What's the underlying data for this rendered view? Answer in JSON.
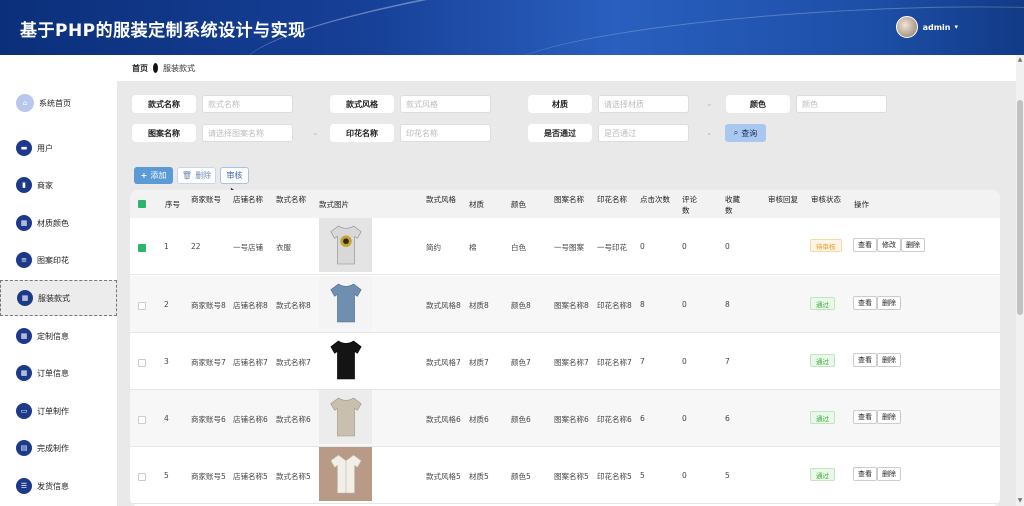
{
  "header": {
    "title": "基于PHP的服装定制系统设计与实现",
    "user": "admin",
    "caret": "▾"
  },
  "sidebar": {
    "items": [
      {
        "label": "系统首页",
        "icon": "home-icon"
      },
      {
        "label": "用户",
        "icon": "chat-icon"
      },
      {
        "label": "商家",
        "icon": "chart-icon"
      },
      {
        "label": "材质颜色",
        "icon": "grid-icon"
      },
      {
        "label": "图案印花",
        "icon": "list-icon"
      },
      {
        "label": "服装款式",
        "icon": "grid-icon"
      },
      {
        "label": "定制信息",
        "icon": "grid-icon"
      },
      {
        "label": "订单信息",
        "icon": "grid-icon"
      },
      {
        "label": "订单制作",
        "icon": "monitor-icon"
      },
      {
        "label": "完成制作",
        "icon": "clipboard-icon"
      },
      {
        "label": "发货信息",
        "icon": "sliders-icon"
      }
    ],
    "active_index": 5
  },
  "breadcrumb": {
    "home": "首页",
    "current": "服装款式"
  },
  "filters": {
    "style_name": {
      "label": "款式名称",
      "placeholder": "款式名称"
    },
    "style": {
      "label": "款式风格",
      "placeholder": "款式风格"
    },
    "material": {
      "label": "材质",
      "placeholder": "请选择材质"
    },
    "color": {
      "label": "颜色",
      "placeholder": "颜色"
    },
    "pattern_name": {
      "label": "图案名称",
      "placeholder": "请选择图案名称"
    },
    "print_name": {
      "label": "印花名称",
      "placeholder": "印花名称"
    },
    "approved": {
      "label": "是否通过",
      "placeholder": "是否通过"
    },
    "search_label": "查询"
  },
  "actions": {
    "add": "添加",
    "delete": "删除",
    "audit": "审核"
  },
  "table": {
    "headers": {
      "index": "序号",
      "merchant": "商家账号",
      "store": "店铺名称",
      "style_name": "款式名称",
      "image": "款式图片",
      "style": "款式风格",
      "material": "材质",
      "color": "颜色",
      "pattern": "图案名称",
      "print": "印花名称",
      "clicks": "点击次数",
      "comments": "评论数",
      "favorites": "收藏数",
      "reply": "审核回复",
      "status": "审核状态",
      "ops": "操作"
    },
    "rows": [
      {
        "index": "1",
        "merchant": "22",
        "store": "一号店铺",
        "style_name": "衣服",
        "style": "简约",
        "material": "棉",
        "color": "白色",
        "pattern": "一号图案",
        "print": "一号印花",
        "clicks": "0",
        "comments": "0",
        "favorites": "0",
        "status": "待审核",
        "status_type": "pending",
        "ops": [
          "查看",
          "修改",
          "删除"
        ],
        "checked": true,
        "shirt_color": "#cfcfcf",
        "shirt_type": "tshirt"
      },
      {
        "index": "2",
        "merchant": "商家账号8",
        "store": "店铺名称8",
        "style_name": "款式名称8",
        "style": "款式风格8",
        "material": "材质8",
        "color": "颜色8",
        "pattern": "图案名称8",
        "print": "印花名称8",
        "clicks": "8",
        "comments": "0",
        "favorites": "8",
        "status": "通过",
        "status_type": "pass",
        "ops": [
          "查看",
          "删除"
        ],
        "checked": false,
        "shirt_color": "#6f8fb0",
        "shirt_type": "tshirt"
      },
      {
        "index": "3",
        "merchant": "商家账号7",
        "store": "店铺名称7",
        "style_name": "款式名称7",
        "style": "款式风格7",
        "material": "材质7",
        "color": "颜色7",
        "pattern": "图案名称7",
        "print": "印花名称7",
        "clicks": "7",
        "comments": "0",
        "favorites": "7",
        "status": "通过",
        "status_type": "pass",
        "ops": [
          "查看",
          "删除"
        ],
        "checked": false,
        "shirt_color": "#141414",
        "shirt_type": "tshirt"
      },
      {
        "index": "4",
        "merchant": "商家账号6",
        "store": "店铺名称6",
        "style_name": "款式名称6",
        "style": "款式风格6",
        "material": "材质6",
        "color": "颜色6",
        "pattern": "图案名称6",
        "print": "印花名称6",
        "clicks": "6",
        "comments": "0",
        "favorites": "6",
        "status": "通过",
        "status_type": "pass",
        "ops": [
          "查看",
          "删除"
        ],
        "checked": false,
        "shirt_color": "#c9bfae",
        "shirt_type": "tshirt"
      },
      {
        "index": "5",
        "merchant": "商家账号5",
        "store": "店铺名称5",
        "style_name": "款式名称5",
        "style": "款式风格5",
        "material": "材质5",
        "color": "颜色5",
        "pattern": "图案名称5",
        "print": "印花名称5",
        "clicks": "5",
        "comments": "0",
        "favorites": "5",
        "status": "通过",
        "status_type": "pass",
        "ops": [
          "查看",
          "删除"
        ],
        "checked": false,
        "shirt_color": "#f2efe9",
        "shirt_type": "shirt"
      }
    ]
  },
  "colors": {
    "header_blue": "#163f96",
    "sidebar_icon": "#1d3a8a",
    "add_button": "#5b9bd5",
    "search_button": "#a8c8ef"
  }
}
